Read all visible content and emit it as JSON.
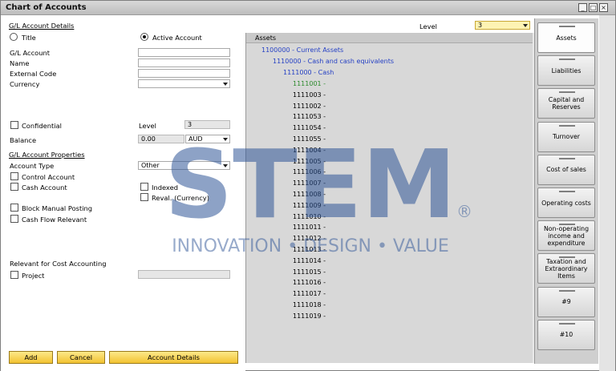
{
  "window": {
    "title": "Chart of Accounts",
    "minimize_glyph": "_",
    "restore_glyph": "□",
    "close_glyph": "×"
  },
  "left": {
    "section_details": "G/L Account Details",
    "radio_title": "Title",
    "radio_active": "Active Account",
    "gl_account_label": "G/L Account",
    "name_label": "Name",
    "external_code_label": "External Code",
    "currency_label": "Currency",
    "confidential_label": "Confidential",
    "level_label": "Level",
    "level_value": "3",
    "balance_label": "Balance",
    "balance_value": "0.00",
    "balance_currency": "AUD",
    "section_properties": "G/L Account Properties",
    "account_type_label": "Account Type",
    "account_type_value": "Other",
    "control_account_label": "Control Account",
    "cash_account_label": "Cash Account",
    "indexed_label": "Indexed",
    "reval_label": "Reval. (Currency)",
    "block_posting_label": "Block Manual Posting",
    "cash_flow_label": "Cash Flow Relevant",
    "cost_accounting_label": "Relevant for Cost Accounting",
    "project_label": "Project"
  },
  "buttons": {
    "add": "Add",
    "cancel": "Cancel",
    "account_details": "Account Details"
  },
  "top_level": {
    "label": "Level",
    "value": "3"
  },
  "tree": {
    "root": "Assets",
    "current_assets": "1100000 - Current Assets",
    "cash_equivalents": "1110000 - Cash and cash equivalents",
    "cash": "1111000 - Cash",
    "accounts": [
      "1111001 -",
      "1111003 -",
      "1111002 -",
      "1111053 -",
      "1111054 -",
      "1111055 -",
      "1111004 -",
      "1111005 -",
      "1111006 -",
      "1111007 -",
      "1111008 -",
      "1111009 -",
      "1111010 -",
      "1111011 -",
      "1111012 -",
      "1111013 -",
      "1111014 -",
      "1111015 -",
      "1111016 -",
      "1111017 -",
      "1111018 -",
      "1111019 -"
    ]
  },
  "drawers": [
    "Assets",
    "Liabilities",
    "Capital and Reserves",
    "Turnover",
    "Cost of sales",
    "Operating costs",
    "Non-operating income and expenditure",
    "Taxation and Extraordinary Items",
    "#9",
    "#10"
  ],
  "watermark": {
    "brand": "STEM",
    "registered": "®",
    "tagline": "INNOVATION • DESIGN • VALUE",
    "brand_color": "#2f5597"
  }
}
